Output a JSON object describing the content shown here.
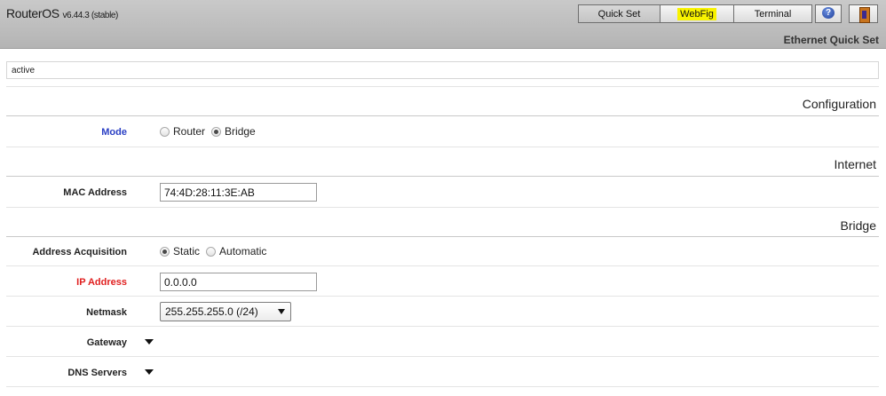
{
  "header": {
    "brand": "RouterOS",
    "version": "v6.44.3 (stable)",
    "nav": {
      "quick_set": "Quick Set",
      "webfig": "WebFig",
      "terminal": "Terminal",
      "help_icon": "help-icon",
      "logout_icon": "exit-door-icon"
    },
    "page_title": "Ethernet Quick Set"
  },
  "status": {
    "value": "active"
  },
  "configuration": {
    "title": "Configuration",
    "mode": {
      "label": "Mode",
      "options": [
        "Router",
        "Bridge"
      ],
      "selected": "Bridge"
    }
  },
  "internet": {
    "title": "Internet",
    "mac_address": {
      "label": "MAC Address",
      "value": "74:4D:28:11:3E:AB"
    }
  },
  "bridge": {
    "title": "Bridge",
    "address_acquisition": {
      "label": "Address Acquisition",
      "options": [
        "Static",
        "Automatic"
      ],
      "selected": "Static"
    },
    "ip_address": {
      "label": "IP Address",
      "value": "0.0.0.0"
    },
    "netmask": {
      "label": "Netmask",
      "value": "255.255.255.0 (/24)"
    },
    "gateway": {
      "label": "Gateway"
    },
    "dns_servers": {
      "label": "DNS Servers"
    }
  },
  "colors": {
    "header_bg": "#c0c0c0",
    "webfig_highlight": "#f8f200",
    "label_blue": "#2a3fc4",
    "label_red": "#e02020"
  }
}
